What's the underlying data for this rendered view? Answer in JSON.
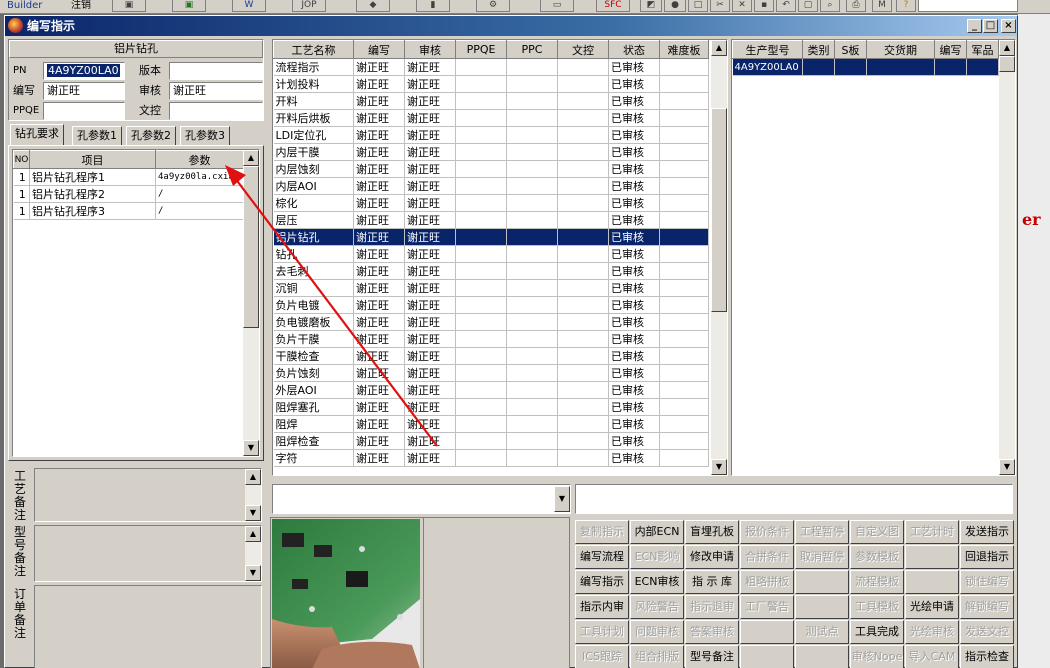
{
  "topbar": {
    "builder": "Builder",
    "cancel": "注销",
    "items": [
      "JOP",
      "SFC"
    ]
  },
  "outside_deco": "er",
  "window": {
    "title": "编写指示"
  },
  "left": {
    "header": "铝片钻孔",
    "labels": {
      "pn": "PN",
      "version": "版本",
      "writer": "编写",
      "reviewer": "审核",
      "ppqe": "PPQE",
      "document_control": "文控"
    },
    "values": {
      "pn": "4A9YZ00LA0",
      "version": "",
      "writer": "谢正旺",
      "reviewer": "谢正旺",
      "ppqe": "",
      "document_control": ""
    },
    "tabs": [
      "钻孔要求",
      "孔参数1",
      "孔参数2",
      "孔参数3"
    ],
    "param_grid": {
      "columns": [
        "NO",
        "项目",
        "参数"
      ],
      "rows": [
        [
          "1",
          "铝片钻孔程序1",
          "4a9yz00la.cxia"
        ],
        [
          "1",
          "铝片钻孔程序2",
          "/"
        ],
        [
          "1",
          "铝片钻孔程序3",
          "/"
        ]
      ]
    },
    "notes": {
      "process": "工艺备注",
      "model": "型号备注",
      "order": "订单备注"
    }
  },
  "process_grid": {
    "columns": [
      "工艺名称",
      "编写",
      "审核",
      "PPQE",
      "PPC",
      "文控",
      "状态",
      "难度板"
    ],
    "selected_index": 10,
    "rows": [
      [
        "流程指示",
        "谢正旺",
        "谢正旺",
        "",
        "",
        "",
        "已审核",
        ""
      ],
      [
        "计划投料",
        "谢正旺",
        "谢正旺",
        "",
        "",
        "",
        "已审核",
        ""
      ],
      [
        "开料",
        "谢正旺",
        "谢正旺",
        "",
        "",
        "",
        "已审核",
        ""
      ],
      [
        "开料后烘板",
        "谢正旺",
        "谢正旺",
        "",
        "",
        "",
        "已审核",
        ""
      ],
      [
        "LDI定位孔",
        "谢正旺",
        "谢正旺",
        "",
        "",
        "",
        "已审核",
        ""
      ],
      [
        "内层干膜",
        "谢正旺",
        "谢正旺",
        "",
        "",
        "",
        "已审核",
        ""
      ],
      [
        "内层蚀刻",
        "谢正旺",
        "谢正旺",
        "",
        "",
        "",
        "已审核",
        ""
      ],
      [
        "内层AOI",
        "谢正旺",
        "谢正旺",
        "",
        "",
        "",
        "已审核",
        ""
      ],
      [
        "棕化",
        "谢正旺",
        "谢正旺",
        "",
        "",
        "",
        "已审核",
        ""
      ],
      [
        "层压",
        "谢正旺",
        "谢正旺",
        "",
        "",
        "",
        "已审核",
        ""
      ],
      [
        "铝片钻孔",
        "谢正旺",
        "谢正旺",
        "",
        "",
        "",
        "已审核",
        ""
      ],
      [
        "钻孔",
        "谢正旺",
        "谢正旺",
        "",
        "",
        "",
        "已审核",
        ""
      ],
      [
        "去毛刺",
        "谢正旺",
        "谢正旺",
        "",
        "",
        "",
        "已审核",
        ""
      ],
      [
        "沉铜",
        "谢正旺",
        "谢正旺",
        "",
        "",
        "",
        "已审核",
        ""
      ],
      [
        "负片电镀",
        "谢正旺",
        "谢正旺",
        "",
        "",
        "",
        "已审核",
        ""
      ],
      [
        "负电镀磨板",
        "谢正旺",
        "谢正旺",
        "",
        "",
        "",
        "已审核",
        ""
      ],
      [
        "负片干膜",
        "谢正旺",
        "谢正旺",
        "",
        "",
        "",
        "已审核",
        ""
      ],
      [
        "干膜检查",
        "谢正旺",
        "谢正旺",
        "",
        "",
        "",
        "已审核",
        ""
      ],
      [
        "负片蚀刻",
        "谢正旺",
        "谢正旺",
        "",
        "",
        "",
        "已审核",
        ""
      ],
      [
        "外层AOI",
        "谢正旺",
        "谢正旺",
        "",
        "",
        "",
        "已审核",
        ""
      ],
      [
        "阻焊塞孔",
        "谢正旺",
        "谢正旺",
        "",
        "",
        "",
        "已审核",
        ""
      ],
      [
        "阻焊",
        "谢正旺",
        "谢正旺",
        "",
        "",
        "",
        "已审核",
        ""
      ],
      [
        "阻焊检查",
        "谢正旺",
        "谢正旺",
        "",
        "",
        "",
        "已审核",
        ""
      ],
      [
        "字符",
        "谢正旺",
        "谢正旺",
        "",
        "",
        "",
        "已审核",
        ""
      ]
    ]
  },
  "product_grid": {
    "columns": [
      "生产型号",
      "类别",
      "S板",
      "交货期",
      "编写",
      "军品"
    ],
    "rows": [
      [
        "4A9YZ00LA0",
        "",
        "",
        "",
        "",
        ""
      ]
    ]
  },
  "buttons": [
    [
      {
        "label": "复制指示",
        "enabled": false
      },
      {
        "label": "内部ECN",
        "enabled": true
      },
      {
        "label": "盲埋孔板",
        "enabled": true
      },
      {
        "label": "报价条件",
        "enabled": false
      },
      {
        "label": "工程暂停",
        "enabled": false
      },
      {
        "label": "自定义图",
        "enabled": false
      },
      {
        "label": "工艺计时",
        "enabled": false
      },
      {
        "label": "发送指示",
        "enabled": true
      }
    ],
    [
      {
        "label": "编写流程",
        "enabled": true
      },
      {
        "label": "ECN影响",
        "enabled": false
      },
      {
        "label": "修改申请",
        "enabled": true
      },
      {
        "label": "合拼条件",
        "enabled": false
      },
      {
        "label": "取消暂停",
        "enabled": false
      },
      {
        "label": "参数模板",
        "enabled": false
      },
      {
        "label": "",
        "enabled": false
      },
      {
        "label": "回退指示",
        "enabled": true
      }
    ],
    [
      {
        "label": "编写指示",
        "enabled": true
      },
      {
        "label": "ECN审核",
        "enabled": true
      },
      {
        "label": "指 示 库",
        "enabled": true
      },
      {
        "label": "粗略拼板",
        "enabled": false
      },
      {
        "label": "",
        "enabled": false
      },
      {
        "label": "流程模板",
        "enabled": false
      },
      {
        "label": "",
        "enabled": false
      },
      {
        "label": "锁住编写",
        "enabled": false
      }
    ],
    [
      {
        "label": "指示内审",
        "enabled": true
      },
      {
        "label": "风险警告",
        "enabled": false
      },
      {
        "label": "指示退审",
        "enabled": false
      },
      {
        "label": "工厂警告",
        "enabled": false
      },
      {
        "label": "",
        "enabled": false
      },
      {
        "label": "工具模板",
        "enabled": false
      },
      {
        "label": "光绘申请",
        "enabled": true
      },
      {
        "label": "解锁编写",
        "enabled": false
      }
    ],
    [
      {
        "label": "工具计划",
        "enabled": false
      },
      {
        "label": "问题审核",
        "enabled": false
      },
      {
        "label": "答案审核",
        "enabled": false
      },
      {
        "label": "",
        "enabled": false
      },
      {
        "label": "测试点",
        "enabled": false
      },
      {
        "label": "工具完成",
        "enabled": true
      },
      {
        "label": "光绘审核",
        "enabled": false
      },
      {
        "label": "发送文控",
        "enabled": false
      }
    ],
    [
      {
        "label": "ICS跟踪",
        "enabled": false
      },
      {
        "label": "组合排版",
        "enabled": false
      },
      {
        "label": "型号备注",
        "enabled": true
      },
      {
        "label": "",
        "enabled": false
      },
      {
        "label": "",
        "enabled": false
      },
      {
        "label": "审核Nope",
        "enabled": false
      },
      {
        "label": "导入CAM",
        "enabled": false
      },
      {
        "label": "指示检查",
        "enabled": true
      }
    ]
  ],
  "colors": {
    "selection": "#0a246a",
    "annotation_arrow": "#e01010",
    "face": "#d4d0c8"
  }
}
